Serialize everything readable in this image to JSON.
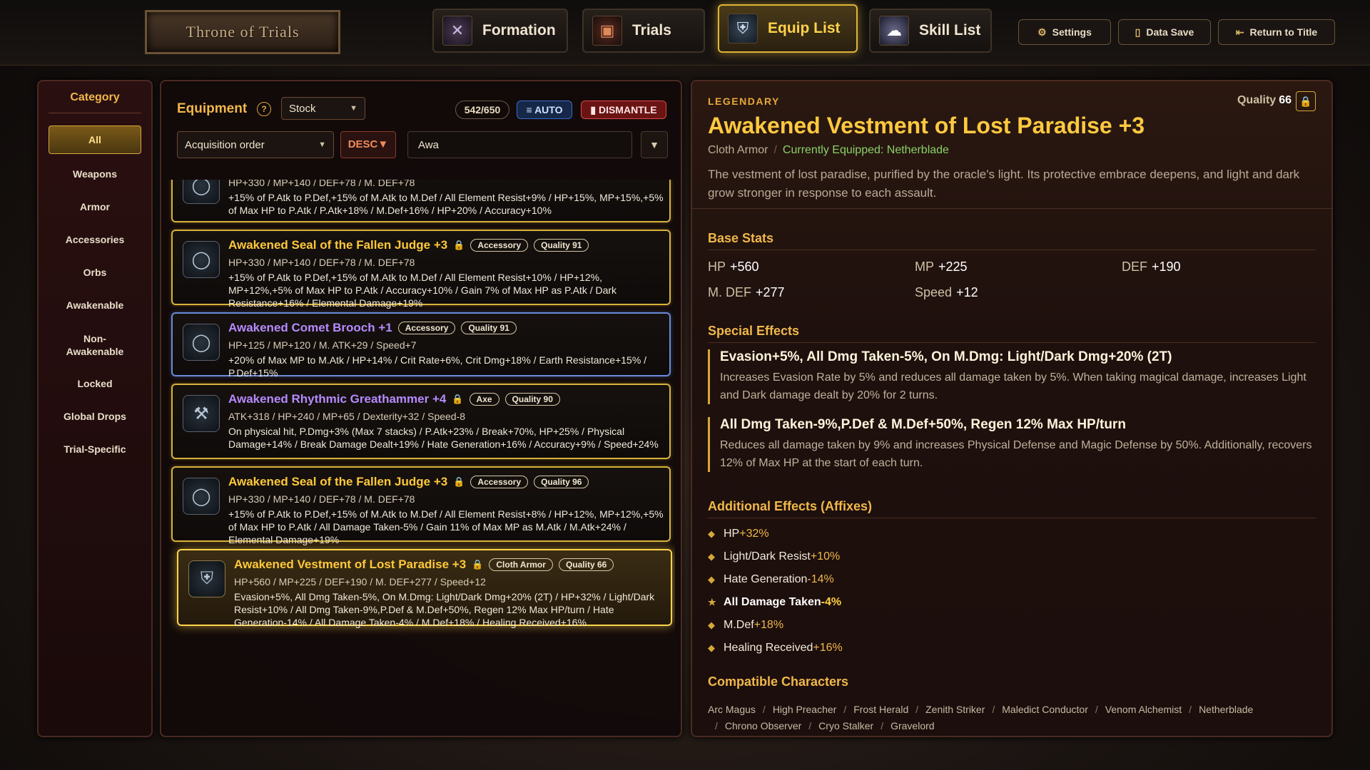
{
  "header": {
    "logo_text": "Throne of Trials",
    "nav": [
      {
        "label": "Formation",
        "icon": "formation-icon"
      },
      {
        "label": "Trials",
        "icon": "trials-icon"
      },
      {
        "label": "Equip List",
        "icon": "equip-icon"
      },
      {
        "label": "Skill List",
        "icon": "skill-icon"
      }
    ],
    "settings_label": "Settings",
    "data_save_label": "Data Save",
    "return_label": "Return to Title"
  },
  "category": {
    "title": "Category",
    "items": [
      "All",
      "Weapons",
      "Armor",
      "Accessories",
      "Orbs",
      "Awakenable",
      "Non-Awakenable",
      "Locked",
      "Global Drops",
      "Trial-Specific"
    ],
    "active": "All"
  },
  "equipment": {
    "title": "Equipment",
    "help": "?",
    "stock_select": "Stock",
    "count": "542/650",
    "auto_label": "AUTO",
    "dismantle_label": "DISMANTLE",
    "sort_select": "Acquisition order",
    "desc_label": "DESC",
    "search_value": "Awa",
    "items": [
      {
        "name": "",
        "tag": "",
        "quality": "",
        "stats": "HP+330 / MP+140 / DEF+78 / M. DEF+78",
        "effects": "+15% of P.Atk to P.Def,+15% of M.Atk to M.Def / All Element Resist+9% / HP+15%, MP+15%,+5% of Max HP to P.Atk / P.Atk+18% / M.Def+16% / HP+20% / Accuracy+10%"
      },
      {
        "name": "Awakened Seal of the Fallen Judge +3",
        "tag": "Accessory",
        "quality": "Quality 91",
        "stats": "HP+330 / MP+140 / DEF+78 / M. DEF+78",
        "effects": "+15% of P.Atk to P.Def,+15% of M.Atk to M.Def / All Element Resist+10% / HP+12%, MP+12%,+5% of Max HP to P.Atk / Accuracy+10% / Gain 7% of Max HP as P.Atk / Dark Resistance+16% / Elemental Damage+19%"
      },
      {
        "name": "Awakened Comet Brooch +1",
        "tag": "Accessory",
        "quality": "Quality 91",
        "stats": "HP+125 / MP+120 / M. ATK+29 / Speed+7",
        "effects": "+20% of Max MP to M.Atk / HP+14% / Crit Rate+6%, Crit Dmg+18% / Earth Resistance+15% / P.Def+15%"
      },
      {
        "name": "Awakened Rhythmic Greathammer +4",
        "tag": "Axe",
        "quality": "Quality 90",
        "stats": "ATK+318 / HP+240 / MP+65 / Dexterity+32 / Speed-8",
        "effects": "On physical hit, P.Dmg+3% (Max 7 stacks) / P.Atk+23% / Break+70%, HP+25% / Physical Damage+14% / Break Damage Dealt+19% / Hate Generation+16% / Accuracy+9% / Speed+24%"
      },
      {
        "name": "Awakened Seal of the Fallen Judge +3",
        "tag": "Accessory",
        "quality": "Quality 96",
        "stats": "HP+330 / MP+140 / DEF+78 / M. DEF+78",
        "effects": "+15% of P.Atk to P.Def,+15% of M.Atk to M.Def / All Element Resist+8% / HP+12%, MP+12%,+5% of Max HP to P.Atk / All Damage Taken-5% / Gain 11% of Max MP as M.Atk / M.Atk+24% / Elemental Damage+19%"
      },
      {
        "name": "Awakened Vestment of Lost Paradise +3",
        "tag": "Cloth Armor",
        "quality": "Quality 66",
        "stats": "HP+560 / MP+225 / DEF+190 / M. DEF+277 / Speed+12",
        "effects": "Evasion+5%, All Dmg Taken-5%, On M.Dmg: Light/Dark Dmg+20% (2T) / HP+32% / Light/Dark Resist+10% / All Dmg Taken-9%,P.Def & M.Def+50%, Regen 12% Max HP/turn / Hate Generation-14% / All Damage Taken-4% / M.Def+18% / Healing Received+16%"
      }
    ]
  },
  "detail": {
    "rarity": "LEGENDARY",
    "quality_label": "Quality",
    "quality_value": "66",
    "name": "Awakened Vestment of Lost Paradise +3",
    "type": "Cloth Armor",
    "equipped": "Currently Equipped: Netherblade",
    "description": "The vestment of lost paradise, purified by the oracle's light. Its protective embrace deepens, and light and dark grow stronger in response to each assault.",
    "base_stats_title": "Base Stats",
    "base_stats": [
      {
        "label": "HP",
        "value": "+560"
      },
      {
        "label": "MP",
        "value": "+225"
      },
      {
        "label": "DEF",
        "value": "+190"
      },
      {
        "label": "M. DEF",
        "value": "+277"
      },
      {
        "label": "Speed",
        "value": "+12"
      }
    ],
    "special_title": "Special Effects",
    "special": [
      {
        "title": "Evasion+5%, All Dmg Taken-5%, On M.Dmg: Light/Dark Dmg+20% (2T)",
        "desc": "Increases Evasion Rate by 5% and reduces all damage taken by 5%. When taking magical damage, increases Light and Dark damage dealt by 20% for 2 turns."
      },
      {
        "title": "All Dmg Taken-9%,P.Def & M.Def+50%, Regen 12% Max HP/turn",
        "desc": "Reduces all damage taken by 9% and increases Physical Defense and Magic Defense by 50%. Additionally, recovers 12% of Max HP at the start of each turn."
      }
    ],
    "affix_title": "Additional Effects (Affixes)",
    "affixes": [
      {
        "label": "HP",
        "value": "+32%"
      },
      {
        "label": "Light/Dark Resist",
        "value": "+10%"
      },
      {
        "label": "Hate Generation",
        "value": "-14%"
      },
      {
        "label": "All Damage Taken",
        "value": "-4%"
      },
      {
        "label": "M.Def",
        "value": "+18%"
      },
      {
        "label": "Healing Received",
        "value": "+16%"
      }
    ],
    "compat_title": "Compatible Characters",
    "characters": [
      "Arc Magus",
      "High Preacher",
      "Frost Herald",
      "Zenith Striker",
      "Maledict Conductor",
      "Venom Alchemist",
      "Netherblade",
      "Chrono Observer",
      "Cryo Stalker",
      "Gravelord"
    ]
  }
}
